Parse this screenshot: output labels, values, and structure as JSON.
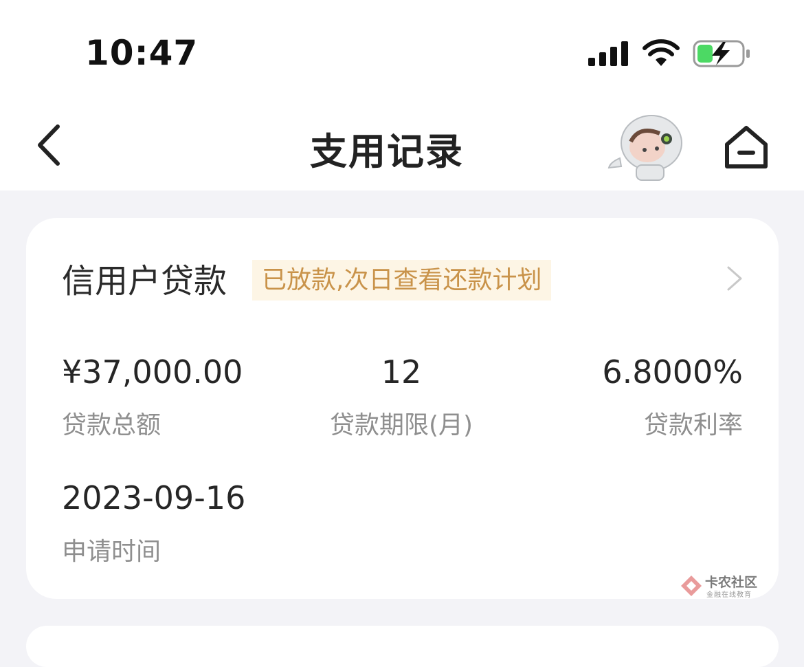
{
  "status_bar": {
    "time": "10:47"
  },
  "header": {
    "title": "支用记录"
  },
  "record": {
    "loan_name": "信用户贷款",
    "status_tag": "已放款,次日查看还款计划",
    "amount": {
      "value": "¥37,000.00",
      "label": "贷款总额"
    },
    "term": {
      "value": "12",
      "label": "贷款期限(月)"
    },
    "rate": {
      "value": "6.8000%",
      "label": "贷款利率"
    },
    "apply_time": {
      "value": "2023-09-16",
      "label": "申请时间"
    }
  },
  "watermark": {
    "title": "卡农社区",
    "subtitle": "金融在线教育"
  },
  "colors": {
    "tag_bg": "#fdf5e5",
    "tag_text": "#c9934a",
    "page_bg": "#f3f3f7",
    "battery_green": "#4cd964"
  },
  "icons": [
    "signal-icon",
    "wifi-icon",
    "battery-icon",
    "back-arrow-icon",
    "astronaut-mascot",
    "home-icon",
    "chevron-right-icon",
    "watermark-logo-icon"
  ]
}
